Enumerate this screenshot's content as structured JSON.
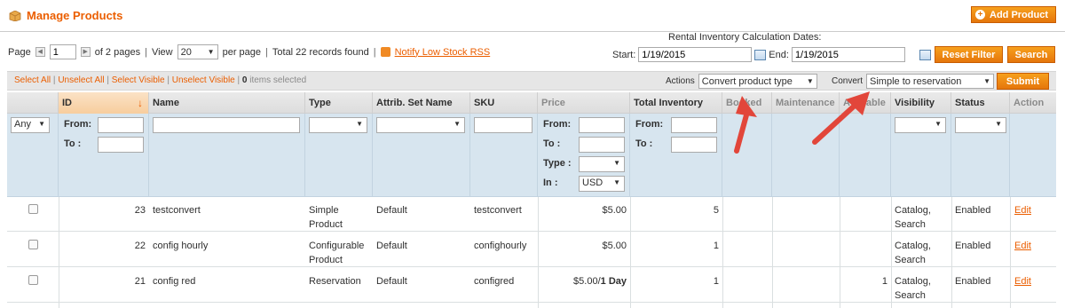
{
  "header": {
    "title": "Manage Products",
    "add_button": "Add Product"
  },
  "pager": {
    "page_label": "Page",
    "page_value": "1",
    "of_pages": "of 2 pages",
    "view_label": "View",
    "per_page": "20",
    "per_page_label": "per page",
    "total": "Total 22 records found",
    "rss_link": "Notify Low Stock RSS"
  },
  "rental": {
    "title": "Rental Inventory Calculation Dates:",
    "start_label": "Start:",
    "start_value": "1/19/2015",
    "end_label": "End:",
    "end_value": "1/19/2015"
  },
  "buttons": {
    "reset": "Reset Filter",
    "search": "Search",
    "submit": "Submit"
  },
  "massaction": {
    "select_all": "Select All",
    "unselect_all": "Unselect All",
    "select_visible": "Select Visible",
    "unselect_visible": "Unselect Visible",
    "selected_count": "0",
    "selected_label": "items selected",
    "actions_label": "Actions",
    "actions_value": "Convert product type",
    "convert_label": "Convert",
    "convert_value": "Simple to reservation"
  },
  "columns": {
    "id": "ID",
    "name": "Name",
    "type": "Type",
    "attrib_set": "Attrib. Set Name",
    "sku": "SKU",
    "price": "Price",
    "total_inventory": "Total Inventory",
    "booked": "Booked",
    "maintenance": "Maintenance",
    "available": "Available",
    "visibility": "Visibility",
    "status": "Status",
    "action": "Action"
  },
  "filters": {
    "any": "Any",
    "from": "From:",
    "to": "To :",
    "type_label": "Type :",
    "in_label": "In :",
    "currency": "USD"
  },
  "rows": [
    {
      "id": "23",
      "name": "testconvert",
      "type_line1": "Simple",
      "type_line2": "Product",
      "attrib": "Default",
      "sku": "testconvert",
      "price_main": "$5.00",
      "price_suffix": "",
      "inventory": "5",
      "available": "",
      "vis_line1": "Catalog,",
      "vis_line2": "Search",
      "status": "Enabled",
      "action": "Edit"
    },
    {
      "id": "22",
      "name": "config hourly",
      "type_line1": "Configurable",
      "type_line2": "Product",
      "attrib": "Default",
      "sku": "confighourly",
      "price_main": "$5.00",
      "price_suffix": "",
      "inventory": "1",
      "available": "",
      "vis_line1": "Catalog,",
      "vis_line2": "Search",
      "status": "Enabled",
      "action": "Edit"
    },
    {
      "id": "21",
      "name": "config red",
      "type_line1": "Reservation",
      "type_line2": "",
      "attrib": "Default",
      "sku": "configred",
      "price_main": "$5.00/",
      "price_suffix": "1 Day",
      "inventory": "1",
      "available": "1",
      "vis_line1": "Catalog,",
      "vis_line2": "Search",
      "status": "Enabled",
      "action": "Edit"
    }
  ],
  "colors": {
    "accent": "#eb5e00",
    "button": "#f08a13",
    "filter_bg": "#d7e5ef",
    "arrow": "#e2463a"
  },
  "icons": [
    "box-icon",
    "plus-circle-icon",
    "rss-icon",
    "calendar-icon",
    "sort-desc-icon",
    "checkbox-icon",
    "annotation-arrow"
  ]
}
